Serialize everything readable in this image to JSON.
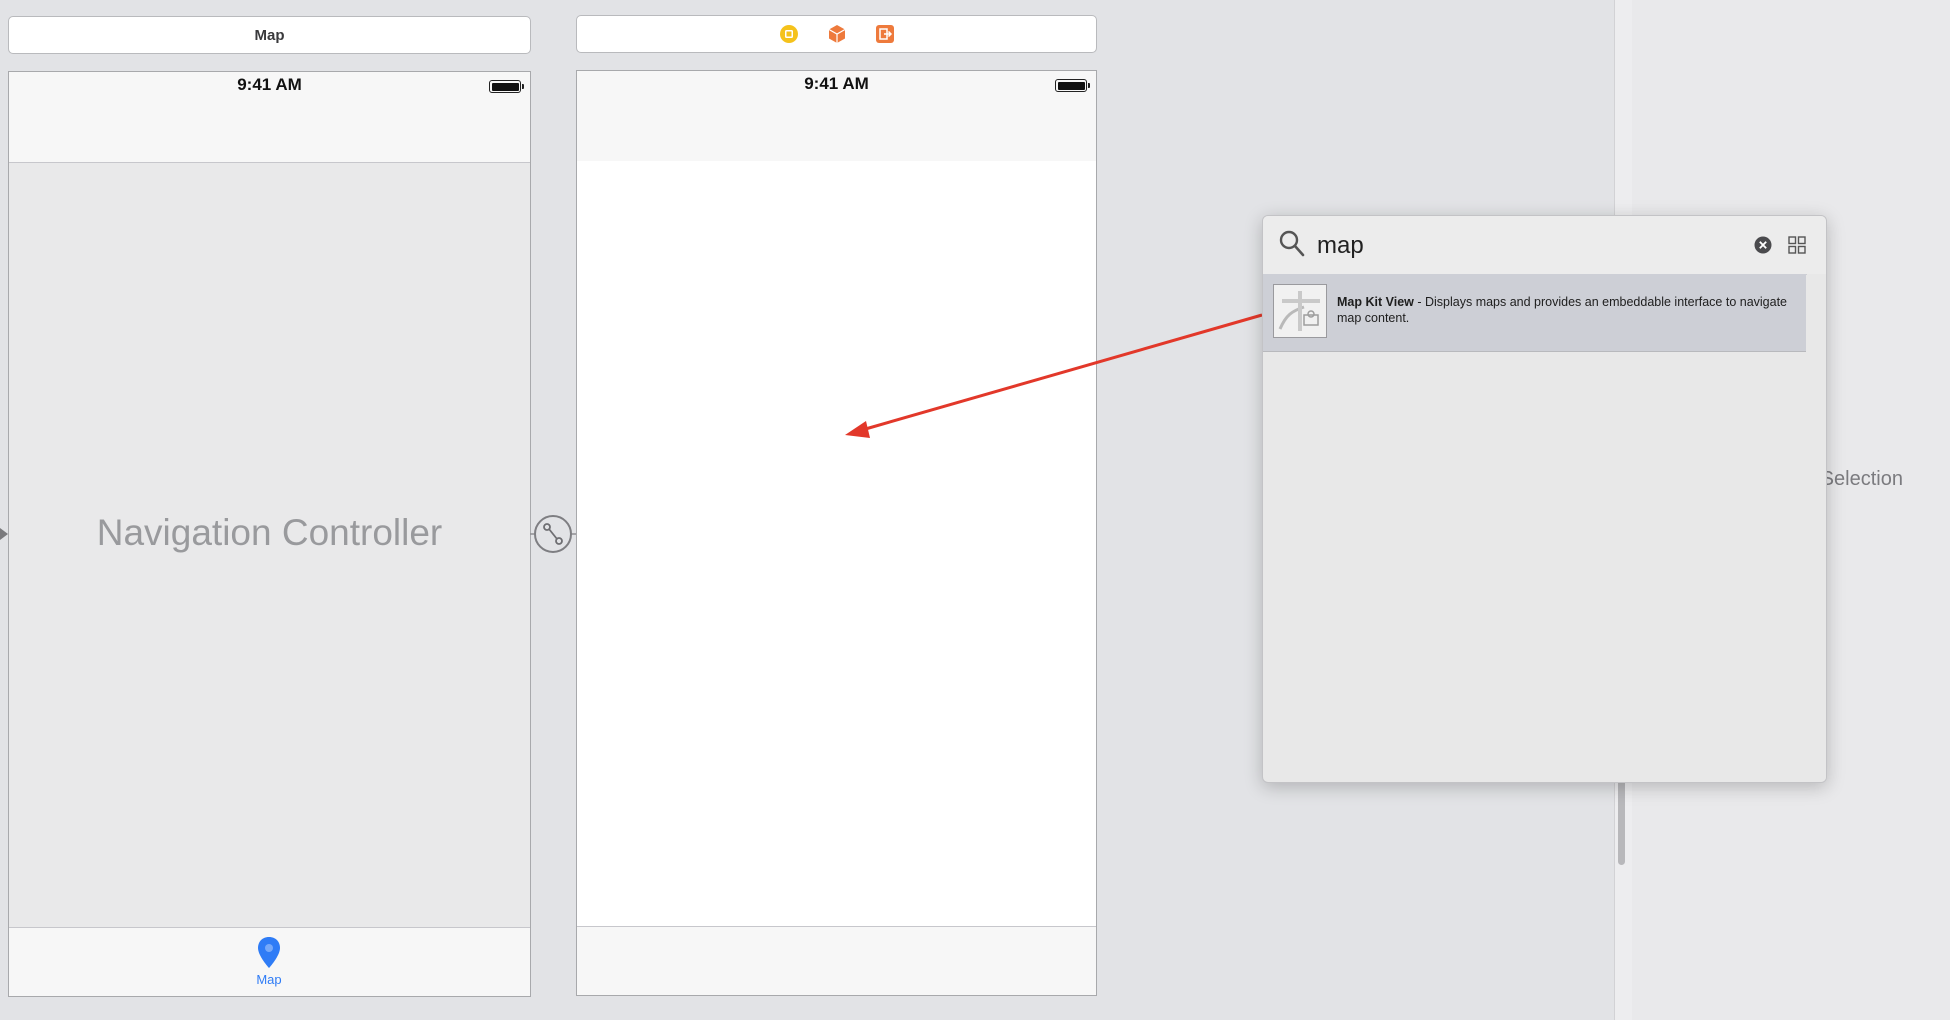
{
  "left_scene": {
    "title": "Map",
    "status_time": "9:41 AM",
    "label": "Navigation Controller",
    "tab_item_label": "Map"
  },
  "right_scene": {
    "status_time": "9:41 AM",
    "dock_icons": [
      "view-controller-icon",
      "first-responder-icon",
      "exit-icon"
    ]
  },
  "library": {
    "search_value": "map",
    "result": {
      "name": "Map Kit View",
      "separator": " - ",
      "description": "Displays maps and provides an embeddable interface to navigate map content."
    }
  },
  "inspector": {
    "placeholder_partial": "o Selection"
  },
  "colors": {
    "canvas": "#e2e3e6",
    "accent_blue": "#2f7cf6",
    "arrow_red": "#e2382a",
    "dock_yellow": "#f5c21b",
    "dock_orange": "#ee7a3c"
  }
}
